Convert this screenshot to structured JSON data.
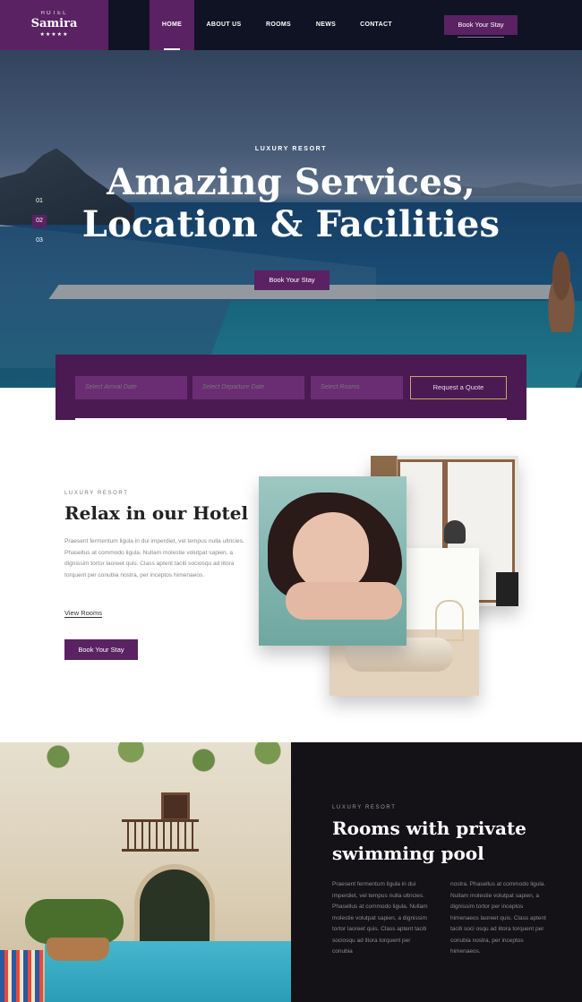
{
  "logo": {
    "sub": "HOTEL",
    "name": "Samira",
    "stars": "★★★★★"
  },
  "nav": {
    "items": [
      "HOME",
      "ABOUT US",
      "ROOMS",
      "NEWS",
      "CONTACT"
    ],
    "active": "HOME",
    "cta": "Book Your Stay"
  },
  "hero": {
    "kicker": "LUXURY RESORT",
    "title_line1": "Amazing Services,",
    "title_line2": "Location & Facilities",
    "button": "Book Your Stay",
    "slides": [
      "01",
      "02",
      "03"
    ],
    "active_slide": "02"
  },
  "booking": {
    "arrival_placeholder": "Select Arrival Date",
    "departure_placeholder": "Select Departure Date",
    "rooms_placeholder": "Select Rooms",
    "quote_button": "Request a Quote"
  },
  "about": {
    "kicker": "LUXURY RESORT",
    "title": "Relax in our Hotel",
    "text": "Praesent fermentum ligula in dui imperdiet, vel tempus nulla ultricies. Phasellus at commodo ligula. Nullam molestie volutpat sapien, a dignissim tortor laoreet quis. Class aptent taciti sociosqu ad litora torquent per conubia nostra, per inceptos himenaeos.",
    "link": "View Rooms",
    "button": "Book Your Stay"
  },
  "rooms": {
    "kicker": "LUXURY RESORT",
    "title": "Rooms with private swimming pool",
    "col1": "Praesent fermentum ligula in dui imperdiet, vel tempus nulla ultricies. Phasellus at commodo ligula. Nullam molestie volutpat sapien, a dignissim tortor laoreet quis. Class aptent taciti sociosqu ad litora torquent per conubia",
    "col2": "nostra. Phasellus at commodo ligula. Nullam molestie volutpat sapien, a dignissim tortor per inceptos himenaeos laoreet quis. Class aptent taciti soci osqu ad litora torquent per conubia nostra, per inceptos himenaeos."
  },
  "colors": {
    "brand": "#5a2263",
    "nav_bg": "#0f1324",
    "booking_bg": "#4b1a52",
    "dark_panel": "#141216"
  }
}
